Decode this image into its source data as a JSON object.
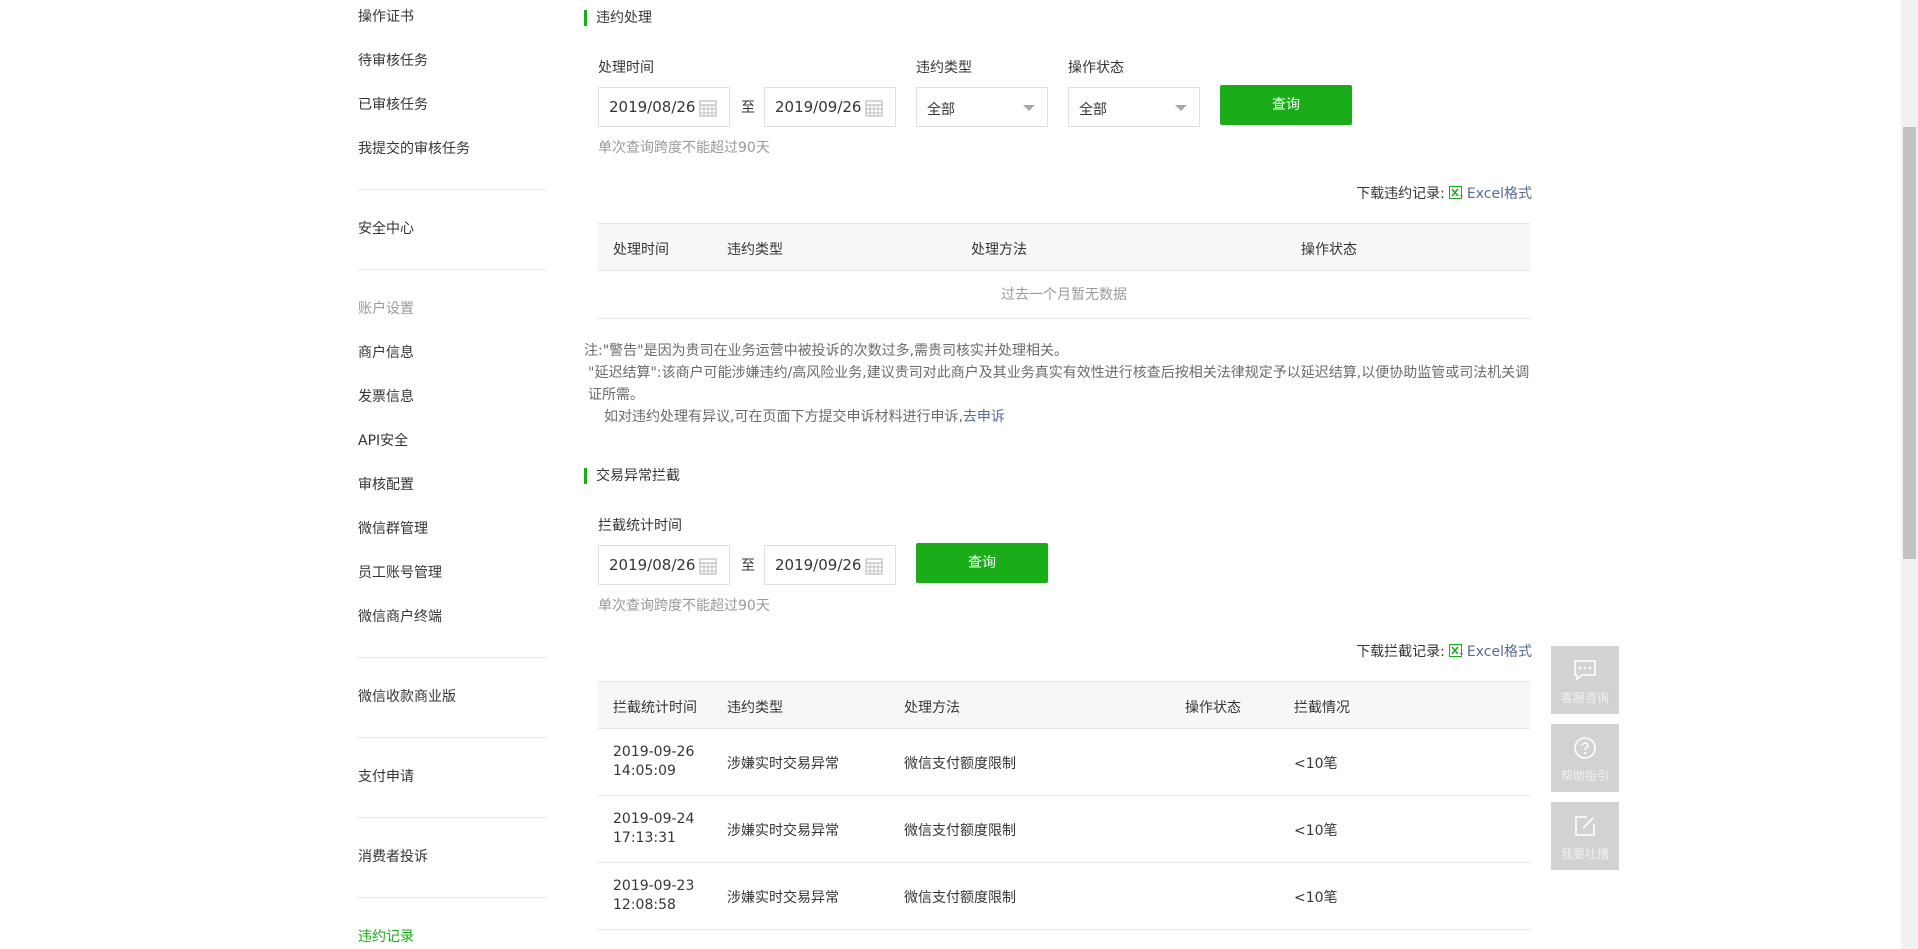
{
  "sidebar": {
    "items": [
      {
        "label": "操作证书"
      },
      {
        "label": "待审核任务"
      },
      {
        "label": "已审核任务"
      },
      {
        "label": "我提交的审核任务"
      },
      {
        "label": "安全中心"
      },
      {
        "label": "账户设置"
      },
      {
        "label": "商户信息"
      },
      {
        "label": "发票信息"
      },
      {
        "label": "API安全"
      },
      {
        "label": "审核配置"
      },
      {
        "label": "微信群管理"
      },
      {
        "label": "员工账号管理"
      },
      {
        "label": "微信商户终端"
      },
      {
        "label": "微信收款商业版"
      },
      {
        "label": "支付申请"
      },
      {
        "label": "消费者投诉"
      },
      {
        "label": "违约记录"
      }
    ]
  },
  "violation": {
    "title": "违约处理",
    "time_label": "处理时间",
    "type_label": "违约类型",
    "status_label": "操作状态",
    "start_date": "2019/08/26",
    "end_date": "2019/09/26",
    "to_text": "至",
    "type_value": "全部",
    "status_value": "全部",
    "query_label": "查询",
    "hint": "单次查询跨度不能超过90天",
    "download_label": "下载违约记录:",
    "excel_label": "Excel格式",
    "columns": [
      "处理时间",
      "违约类型",
      "处理方法",
      "操作状态"
    ],
    "empty_text": "过去一个月暂无数据",
    "note_line1": "注:\"警告\"是因为贵司在业务运营中被投诉的次数过多,需贵司核实并处理相关。",
    "note_line2": "\"延迟结算\":该商户可能涉嫌违约/高风险业务,建议贵司对此商户及其业务真实有效性进行核查后按相关法律规定予以延迟结算,以便协助监管或司法机关调证所需。",
    "note_line3": "如对违约处理有异议,可在页面下方提交申诉材料进行申诉,",
    "appeal_link": "去申诉"
  },
  "intercept": {
    "title": "交易异常拦截",
    "time_label": "拦截统计时间",
    "start_date": "2019/08/26",
    "end_date": "2019/09/26",
    "to_text": "至",
    "query_label": "查询",
    "hint": "单次查询跨度不能超过90天",
    "download_label": "下载拦截记录:",
    "excel_label": "Excel格式",
    "columns": [
      "拦截统计时间",
      "违约类型",
      "处理方法",
      "操作状态",
      "拦截情况"
    ],
    "rows": [
      {
        "time": "2019-09-26 14:05:09",
        "type": "涉嫌实时交易异常",
        "method": "微信支付额度限制",
        "status": "",
        "result": "<10笔"
      },
      {
        "time": "2019-09-24 17:13:31",
        "type": "涉嫌实时交易异常",
        "method": "微信支付额度限制",
        "status": "",
        "result": "<10笔"
      },
      {
        "time": "2019-09-23 12:08:58",
        "type": "涉嫌实时交易异常",
        "method": "微信支付额度限制",
        "status": "",
        "result": "<10笔"
      }
    ]
  },
  "float_tools": [
    {
      "label": "客服咨询",
      "icon": "chat-icon"
    },
    {
      "label": "帮助指引",
      "icon": "help-icon"
    },
    {
      "label": "我要吐槽",
      "icon": "edit-icon"
    }
  ],
  "colors": {
    "accent": "#1aad19",
    "link": "#576b95"
  }
}
